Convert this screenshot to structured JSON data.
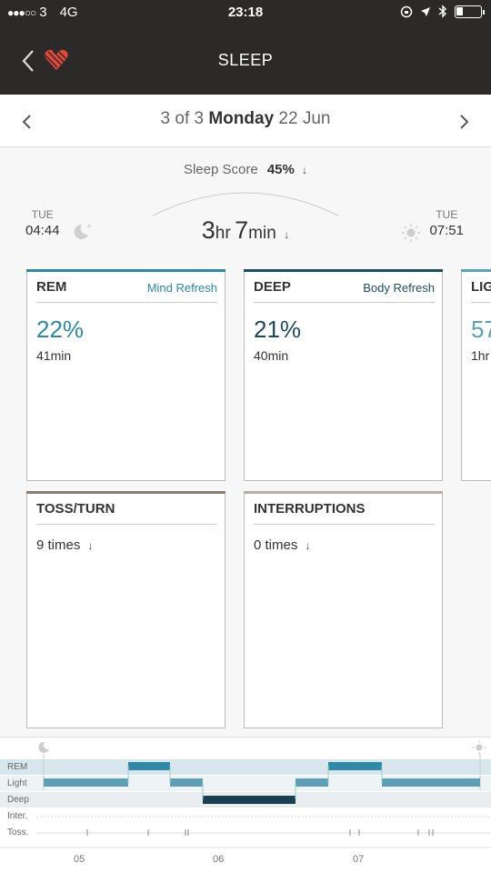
{
  "status_bar": {
    "carrier": "3",
    "network": "4G",
    "time": "23:18"
  },
  "header": {
    "title": "SLEEP"
  },
  "date_nav": {
    "position": "3 of 3",
    "weekday": "Monday",
    "date": "22 Jun"
  },
  "summary": {
    "score_label": "Sleep Score",
    "score_value": "45%",
    "bed_day": "TUE",
    "bed_time": "04:44",
    "wake_day": "TUE",
    "wake_time": "07:51",
    "hours": "3",
    "hours_unit": "hr",
    "minutes": "7",
    "minutes_unit": "min",
    "trend_arrow": "↓"
  },
  "cards": {
    "rem": {
      "name": "REM",
      "tag": "Mind Refresh",
      "pct": "22%",
      "duration": "41min",
      "color": "#2a8aa8"
    },
    "deep": {
      "name": "DEEP",
      "tag": "Body Refresh",
      "pct": "21%",
      "duration": "40min",
      "color": "#1d4b60"
    },
    "light": {
      "name": "LIG",
      "pct": "57",
      "duration": "1hr",
      "color": "#5aa2b8"
    },
    "toss": {
      "name": "TOSS/TURN",
      "value": "9 times",
      "color": "#8a7e72"
    },
    "interruptions": {
      "name": "INTERRUPTIONS",
      "value": "0 times",
      "color": "#b7afa6"
    }
  },
  "timeline": {
    "rows": [
      "REM",
      "Light",
      "Deep",
      "Inter.",
      "Toss."
    ],
    "x_labels": [
      "05",
      "06",
      "07"
    ]
  },
  "colors": {
    "rem": "#2f8aa5",
    "light": "#5d9fb4",
    "deep": "#183f52"
  }
}
